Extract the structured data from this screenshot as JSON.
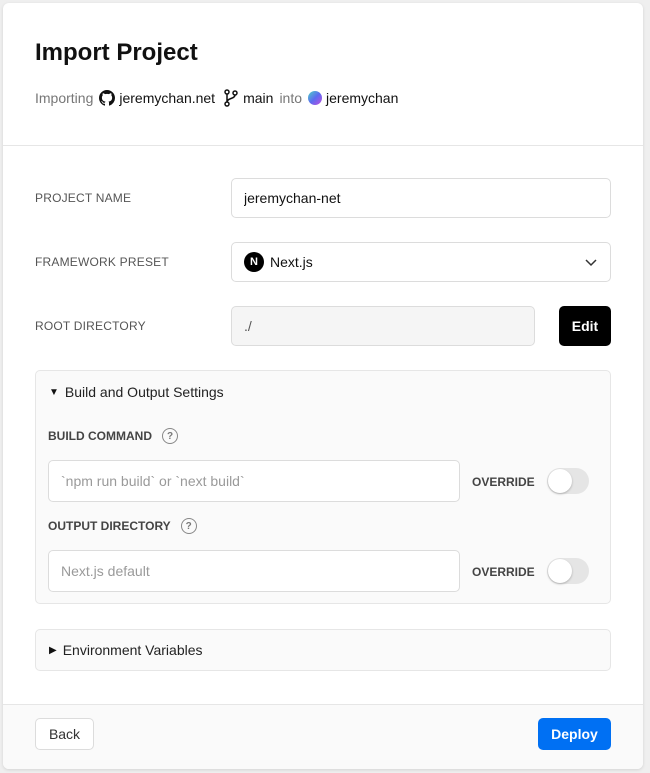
{
  "header": {
    "title": "Import Project",
    "importing_label": "Importing",
    "repo": "jeremychan.net",
    "branch": "main",
    "into_label": "into",
    "scope": "jeremychan"
  },
  "form": {
    "project_name": {
      "label": "PROJECT NAME",
      "value": "jeremychan-net"
    },
    "framework_preset": {
      "label": "FRAMEWORK PRESET",
      "value": "Next.js",
      "icon": "nextjs-logo-icon"
    },
    "root_directory": {
      "label": "ROOT DIRECTORY",
      "value": "./",
      "edit_label": "Edit"
    }
  },
  "build_settings": {
    "title": "Build and Output Settings",
    "expanded": true,
    "build_command": {
      "label": "BUILD COMMAND",
      "placeholder": "`npm run build` or `next build`",
      "override_label": "OVERRIDE",
      "override": false
    },
    "output_directory": {
      "label": "OUTPUT DIRECTORY",
      "placeholder": "Next.js default",
      "override_label": "OVERRIDE",
      "override": false
    }
  },
  "env_vars": {
    "title": "Environment Variables",
    "expanded": false
  },
  "footer": {
    "back_label": "Back",
    "deploy_label": "Deploy"
  },
  "colors": {
    "accent": "#0070f3",
    "primary_button": "#000000"
  }
}
